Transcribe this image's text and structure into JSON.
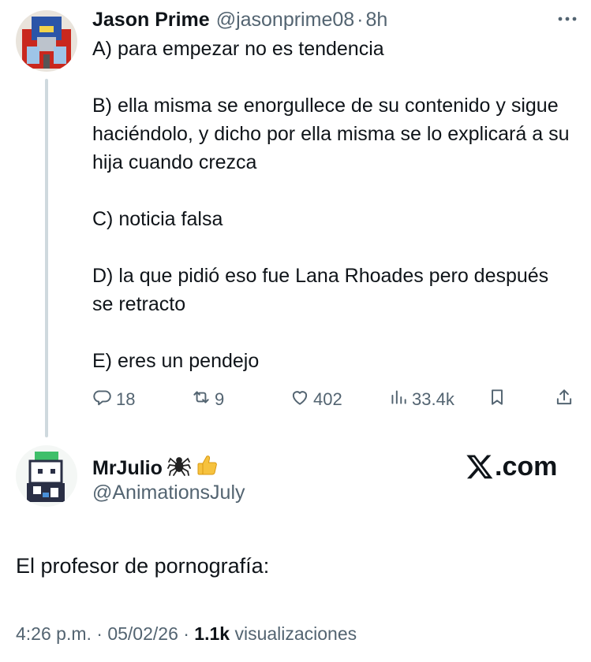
{
  "parent_tweet": {
    "display_name": "Jason Prime",
    "handle": "@jasonprime08",
    "separator": "·",
    "time_ago": "8h",
    "paragraphs": [
      "A) para empezar no es tendencia",
      "B) ella misma se enorgullece de su contenido y sigue haciéndolo, y dicho por ella misma se lo explicará a su hija cuando crezca",
      "C) noticia falsa",
      "D) la que pidió eso fue Lana Rhoades pero después se retracto",
      "E) eres un pendejo"
    ],
    "stats": {
      "replies": "18",
      "reposts": "9",
      "likes": "402",
      "views": "33.4k"
    }
  },
  "main_tweet": {
    "display_name": "MrJulio",
    "name_emojis": [
      "spider-emoji",
      "thumbs-up-emoji"
    ],
    "handle": "@AnimationsJuly",
    "text": "El profesor de pornografía:",
    "timestamp": "4:26 p.m. · 05/02/26 ·",
    "views_count": "1.1k",
    "views_label": "visualizaciones"
  },
  "watermark": {
    "text": ".com"
  },
  "colors": {
    "text": "#0f1419",
    "secondary": "#536471",
    "thread_line": "#cfd9de"
  }
}
